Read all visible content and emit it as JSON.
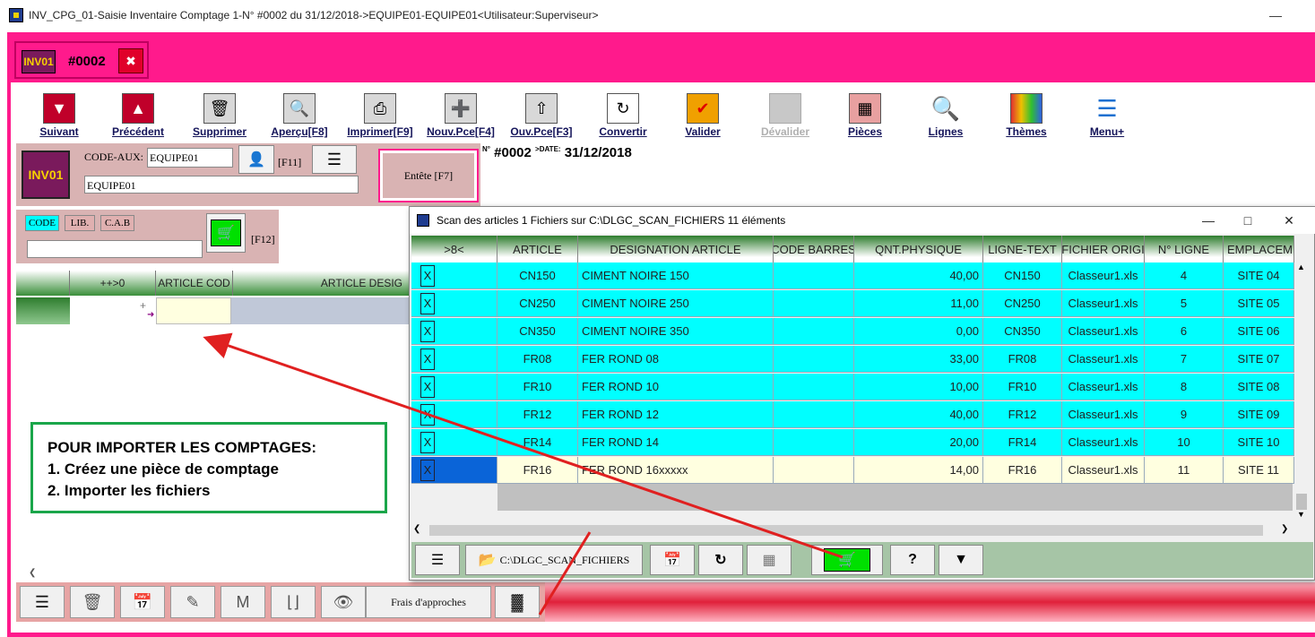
{
  "window": {
    "title": "INV_CPG_01-Saisie Inventaire Comptage 1-N° #0002 du 31/12/2018->EQUIPE01-EQUIPE01<Utilisateur:Superviseur>",
    "controls": [
      "minimize",
      "maximize",
      "close"
    ]
  },
  "doc_tab": {
    "logo_text": "INV01",
    "number": "#0002",
    "close_icon": "close-icon"
  },
  "toolbar": {
    "buttons": [
      {
        "label": "Suivant",
        "icon": "down-arrow-icon",
        "color": "#c0002a"
      },
      {
        "label": "Précédent",
        "icon": "up-arrow-icon",
        "color": "#c0002a"
      },
      {
        "label": "Supprimer",
        "icon": "trash-icon"
      },
      {
        "label": "Aperçu[F8]",
        "icon": "zoom-icon"
      },
      {
        "label": "Imprimer[F9]",
        "icon": "printer-icon"
      },
      {
        "label": "Nouv.Pce[F4]",
        "icon": "plus-icon",
        "color": "#00b000"
      },
      {
        "label": "Ouv.Pce[F3]",
        "icon": "open-up-icon"
      },
      {
        "label": "Convertir",
        "icon": "convert-icon"
      },
      {
        "label": "Valider",
        "icon": "check-icon",
        "color": "#f0a000"
      },
      {
        "label": "Dévalider",
        "icon": "blank-icon",
        "disabled": true
      },
      {
        "label": "Pièces",
        "icon": "pieces-icon",
        "color": "#e08080"
      },
      {
        "label": "Lignes",
        "icon": "magnifier-icon",
        "color": "#1a6fd0"
      },
      {
        "label": "Thèmes",
        "icon": "palette-icon"
      },
      {
        "label": "Menu+",
        "icon": "menu-icon",
        "color": "#1a6fd0"
      }
    ]
  },
  "header": {
    "logo_text": "INV01",
    "code_aux_label": "CODE-AUX:",
    "code_aux_value": "EQUIPE01",
    "f11_label": "[F11]",
    "equipe_value": "EQUIPE01",
    "entete_label": "Entête [F7]",
    "doc_no_sup": "N°",
    "doc_no": "#0002",
    "date_sup": ">DATE:",
    "date": "31/12/2018"
  },
  "search": {
    "tabs": [
      "CODE",
      "LIB.",
      "C.A.B"
    ],
    "value": "",
    "f12_label": "[F12]"
  },
  "main_grid": {
    "headers": [
      "",
      "++>0",
      "ARTICLE COD",
      "ARTICLE DESIG"
    ]
  },
  "note": {
    "lines": [
      "POUR IMPORTER LES COMPTAGES:",
      "1. Créez une pièce de comptage",
      "2. Importer les fichiers"
    ]
  },
  "bottom_bar": {
    "frais_label": "Frais d'approches"
  },
  "dialog": {
    "title": "Scan des articles 1  Fichiers sur C:\\DLGC_SCAN_FICHIERS   11 éléments",
    "headers": [
      ">8<",
      "ARTICLE",
      "DESIGNATION ARTICLE",
      "CODE BARRES",
      "QNT.PHYSIQUE",
      "LIGNE-TEXT",
      "FICHIER ORIGI",
      "N° LIGNE",
      "EMPLACEME"
    ],
    "rows": [
      {
        "x": "X",
        "article": "CN150",
        "designation": "CIMENT NOIRE 150",
        "code_barres": "",
        "qnt": "40,00",
        "ligne_text": "CN150",
        "fichier": "Classeur1.xls",
        "num": "4",
        "emplacement": "SITE 04"
      },
      {
        "x": "X",
        "article": "CN250",
        "designation": "CIMENT NOIRE 250",
        "code_barres": "",
        "qnt": "11,00",
        "ligne_text": "CN250",
        "fichier": "Classeur1.xls",
        "num": "5",
        "emplacement": "SITE 05"
      },
      {
        "x": "X",
        "article": "CN350",
        "designation": "CIMENT NOIRE 350",
        "code_barres": "",
        "qnt": "0,00",
        "ligne_text": "CN350",
        "fichier": "Classeur1.xls",
        "num": "6",
        "emplacement": "SITE 06"
      },
      {
        "x": "X",
        "article": "FR08",
        "designation": "FER ROND 08",
        "code_barres": "",
        "qnt": "33,00",
        "ligne_text": "FR08",
        "fichier": "Classeur1.xls",
        "num": "7",
        "emplacement": "SITE 07"
      },
      {
        "x": "X",
        "article": "FR10",
        "designation": "FER ROND 10",
        "code_barres": "",
        "qnt": "10,00",
        "ligne_text": "FR10",
        "fichier": "Classeur1.xls",
        "num": "8",
        "emplacement": "SITE 08"
      },
      {
        "x": "X",
        "article": "FR12",
        "designation": "FER ROND 12",
        "code_barres": "",
        "qnt": "40,00",
        "ligne_text": "FR12",
        "fichier": "Classeur1.xls",
        "num": "9",
        "emplacement": "SITE 09"
      },
      {
        "x": "X",
        "article": "FR14",
        "designation": "FER ROND 14",
        "code_barres": "",
        "qnt": "20,00",
        "ligne_text": "FR14",
        "fichier": "Classeur1.xls",
        "num": "10",
        "emplacement": "SITE 10"
      },
      {
        "x": "X",
        "article": "FR16",
        "designation": "FER ROND 16xxxxx",
        "code_barres": "",
        "qnt": "14,00",
        "ligne_text": "FR16",
        "fichier": "Classeur1.xls",
        "num": "11",
        "emplacement": "SITE 11"
      }
    ],
    "path_button": "C:\\DLGC_SCAN_FICHIERS",
    "help_label": "?"
  },
  "colors": {
    "frame": "#ff1a8c",
    "row_cyan": "#00ffff",
    "row_selected": "#ffffe0",
    "selection_marker": "#0a64d8",
    "arrow": "#e02020",
    "note_border": "#1aa64a"
  }
}
